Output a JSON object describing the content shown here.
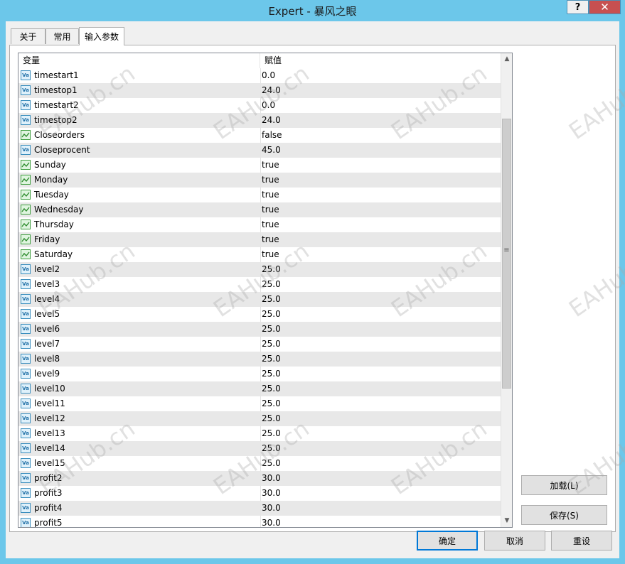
{
  "window": {
    "title": "Expert - 暴风之眼",
    "help_label": "?",
    "close_label": "✕"
  },
  "tabs": [
    {
      "label": "关于",
      "active": false
    },
    {
      "label": "常用",
      "active": false
    },
    {
      "label": "输入参数",
      "active": true
    }
  ],
  "grid": {
    "columns": [
      "变量",
      "赋值"
    ],
    "rows": [
      {
        "name": "timestart1",
        "value": "0.0",
        "type": "value",
        "icon": "value-icon"
      },
      {
        "name": "timestop1",
        "value": "24.0",
        "type": "value",
        "icon": "value-icon"
      },
      {
        "name": "timestart2",
        "value": "0.0",
        "type": "value",
        "icon": "value-icon"
      },
      {
        "name": "timestop2",
        "value": "24.0",
        "type": "value",
        "icon": "value-icon"
      },
      {
        "name": "Closeorders",
        "value": "false",
        "type": "bool",
        "icon": "bool-icon"
      },
      {
        "name": "Closeprocent",
        "value": "45.0",
        "type": "value",
        "icon": "value-icon"
      },
      {
        "name": "Sunday",
        "value": "true",
        "type": "bool",
        "icon": "bool-icon"
      },
      {
        "name": "Monday",
        "value": "true",
        "type": "bool",
        "icon": "bool-icon"
      },
      {
        "name": "Tuesday",
        "value": "true",
        "type": "bool",
        "icon": "bool-icon"
      },
      {
        "name": "Wednesday",
        "value": "true",
        "type": "bool",
        "icon": "bool-icon"
      },
      {
        "name": "Thursday",
        "value": "true",
        "type": "bool",
        "icon": "bool-icon"
      },
      {
        "name": "Friday",
        "value": "true",
        "type": "bool",
        "icon": "bool-icon"
      },
      {
        "name": "Saturday",
        "value": "true",
        "type": "bool",
        "icon": "bool-icon"
      },
      {
        "name": "level2",
        "value": "25.0",
        "type": "value",
        "icon": "value-icon"
      },
      {
        "name": "level3",
        "value": "25.0",
        "type": "value",
        "icon": "value-icon"
      },
      {
        "name": "level4",
        "value": "25.0",
        "type": "value",
        "icon": "value-icon"
      },
      {
        "name": "level5",
        "value": "25.0",
        "type": "value",
        "icon": "value-icon"
      },
      {
        "name": "level6",
        "value": "25.0",
        "type": "value",
        "icon": "value-icon"
      },
      {
        "name": "level7",
        "value": "25.0",
        "type": "value",
        "icon": "value-icon"
      },
      {
        "name": "level8",
        "value": "25.0",
        "type": "value",
        "icon": "value-icon"
      },
      {
        "name": "level9",
        "value": "25.0",
        "type": "value",
        "icon": "value-icon"
      },
      {
        "name": "level10",
        "value": "25.0",
        "type": "value",
        "icon": "value-icon"
      },
      {
        "name": "level11",
        "value": "25.0",
        "type": "value",
        "icon": "value-icon"
      },
      {
        "name": "level12",
        "value": "25.0",
        "type": "value",
        "icon": "value-icon"
      },
      {
        "name": "level13",
        "value": "25.0",
        "type": "value",
        "icon": "value-icon"
      },
      {
        "name": "level14",
        "value": "25.0",
        "type": "value",
        "icon": "value-icon"
      },
      {
        "name": "level15",
        "value": "25.0",
        "type": "value",
        "icon": "value-icon"
      },
      {
        "name": "profit2",
        "value": "30.0",
        "type": "value",
        "icon": "value-icon"
      },
      {
        "name": "profit3",
        "value": "30.0",
        "type": "value",
        "icon": "value-icon"
      },
      {
        "name": "profit4",
        "value": "30.0",
        "type": "value",
        "icon": "value-icon"
      },
      {
        "name": "profit5",
        "value": "30.0",
        "type": "value",
        "icon": "value-icon"
      }
    ]
  },
  "side_buttons": {
    "load": "加载(L)",
    "save": "保存(S)"
  },
  "footer_buttons": {
    "ok": "确定",
    "cancel": "取消",
    "reset": "重设"
  },
  "watermark": "EAHub.cn",
  "colors": {
    "titlebar": "#6cc7ea",
    "close_button": "#c75050",
    "row_alt": "#e8e8e8",
    "default_button_border": "#0078d7"
  }
}
